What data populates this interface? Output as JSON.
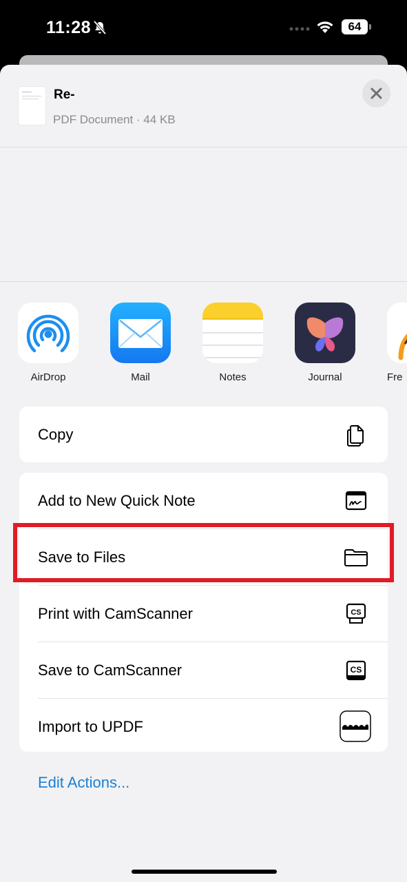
{
  "status_bar": {
    "time": "11:28",
    "battery": "64"
  },
  "document": {
    "title": "Re-",
    "subtitle": "PDF Document · 44 KB"
  },
  "apps": [
    {
      "label": "AirDrop",
      "icon": "airdrop-icon"
    },
    {
      "label": "Mail",
      "icon": "mail-icon"
    },
    {
      "label": "Notes",
      "icon": "notes-icon"
    },
    {
      "label": "Journal",
      "icon": "journal-icon"
    },
    {
      "label": "Fre",
      "icon": "freeform-icon"
    }
  ],
  "actions": {
    "copy": "Copy",
    "quick_note": "Add to New Quick Note",
    "save_files": "Save to Files",
    "print_camscanner": "Print with CamScanner",
    "save_camscanner": "Save to CamScanner",
    "import_updf": "Import to UPDF"
  },
  "edit_actions": "Edit Actions...",
  "colors": {
    "highlight": "#e01b24",
    "link": "#1a7fd6",
    "sheet_bg": "#f2f2f4"
  }
}
